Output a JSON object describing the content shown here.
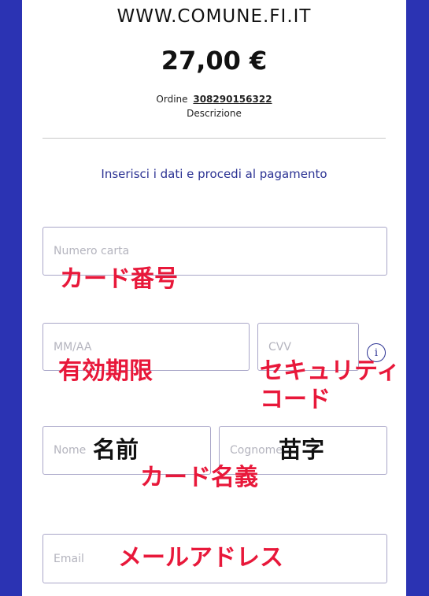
{
  "header": {
    "merchant": "WWW.COMUNE.FI.IT",
    "amount": "27,00 €",
    "order_label": "Ordine",
    "order_number": "308290156322",
    "description": "Descrizione"
  },
  "form": {
    "instructions": "Inserisci i dati e procedi al pagamento",
    "card_number_placeholder": "Numero carta",
    "expiry_placeholder": "MM/AA",
    "cvv_placeholder": "CVV",
    "name_placeholder": "Nome",
    "surname_placeholder": "Cognome",
    "email_placeholder": "Email",
    "info_icon": "i"
  },
  "annotations": {
    "card_number": "カード番号",
    "expiry": "有効期限",
    "security_code_line1": "セキュリティ",
    "security_code_line2": "コード",
    "first_name": "名前",
    "last_name": "苗字",
    "cardholder_name": "カード名義",
    "email": "メールアドレス"
  },
  "colors": {
    "background": "#2b33b3",
    "accent": "#2b3293",
    "annotation": "#e8183a"
  }
}
